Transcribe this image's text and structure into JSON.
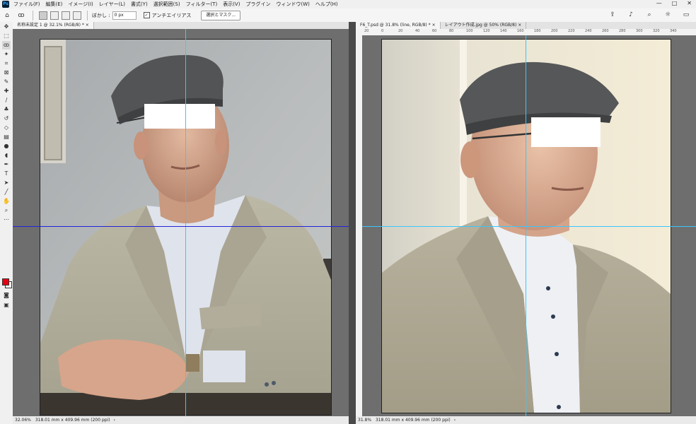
{
  "menubar": {
    "app_icon": "ps-logo",
    "app_icon_label": "Ps",
    "items": [
      "ファイル(F)",
      "編集(E)",
      "イメージ(I)",
      "レイヤー(L)",
      "書式(Y)",
      "選択範囲(S)",
      "フィルター(T)",
      "表示(V)",
      "プラグイン",
      "ウィンドウ(W)",
      "ヘルプ(H)"
    ],
    "window_controls": [
      "—",
      "□",
      "✕"
    ]
  },
  "options": {
    "feather_label": "ぼかし :",
    "feather_value": "0 px",
    "antialias_label": "アンチエイリアス",
    "antialias_checked": "✓",
    "select_mask_label": "選択とマスク...",
    "tool_icon": "lasso-icon",
    "right_icons": [
      "share-icon",
      "bell-icon",
      "search-icon",
      "lightbulb-icon",
      "workspace-icon"
    ]
  },
  "tools": [
    "move-icon",
    "marquee-icon",
    "lasso-icon",
    "magic-wand-icon",
    "crop-icon",
    "frame-icon",
    "eyedropper-icon",
    "healing-brush-icon",
    "brush-icon",
    "stamp-icon",
    "history-brush-icon",
    "eraser-icon",
    "gradient-icon",
    "blur-icon",
    "dodge-icon",
    "pen-icon",
    "type-icon",
    "path-select-icon",
    "shape-icon",
    "hand-icon",
    "zoom-icon",
    "more-icon"
  ],
  "colors": {
    "foreground": "#e60012",
    "background": "#ffffff",
    "guide_cyan": "#39c6ff",
    "guide_blue": "#2323d8"
  },
  "left_doc": {
    "tab_label": "名称未設定 1 @ 32.1% (RGB/8) *",
    "tab_close": "×",
    "zoom": "32.06%",
    "dimensions": "318.01 mm x 409.96 mm (200 ppi)"
  },
  "right_doc": {
    "tabs": [
      {
        "label": "F6_T.psd @ 31.8% (line, RGB/8) *",
        "close": "×"
      },
      {
        "label": "レイアウト作成.jpg @ 50% (RGB/8)",
        "close": "×"
      }
    ],
    "zoom": "31.8%",
    "dimensions": "318.01 mm x 409.96 mm (200 ppi)",
    "ruler_ticks": [
      "20",
      "0",
      "20",
      "40",
      "60",
      "80",
      "100",
      "120",
      "140",
      "160",
      "180",
      "200",
      "220",
      "240",
      "260",
      "280",
      "300",
      "320",
      "340"
    ]
  }
}
